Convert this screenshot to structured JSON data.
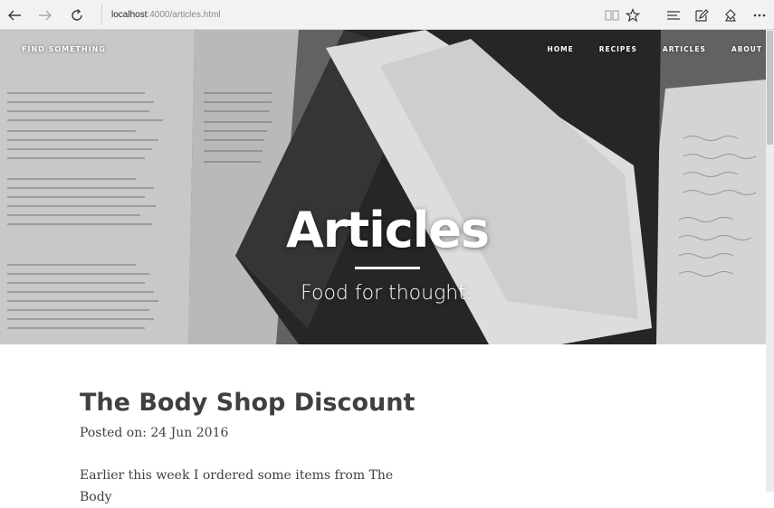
{
  "browser": {
    "url_host": "localhost",
    "url_path": ":4000/articles.html",
    "icons": [
      "back-arrow-icon",
      "forward-arrow-icon",
      "refresh-icon",
      "reading-view-icon",
      "favorite-star-icon",
      "hub-icon",
      "web-note-icon",
      "share-icon",
      "more-icon"
    ]
  },
  "site": {
    "brand": "Find Something",
    "nav": [
      "Home",
      "Recipes",
      "Articles",
      "About"
    ]
  },
  "hero": {
    "title": "Articles",
    "subtitle": "Food for thought."
  },
  "post": {
    "title": "The Body Shop Discount",
    "meta": "Posted on: 24 Jun 2016",
    "excerpt": "Earlier this week I ordered some items from The Body"
  }
}
